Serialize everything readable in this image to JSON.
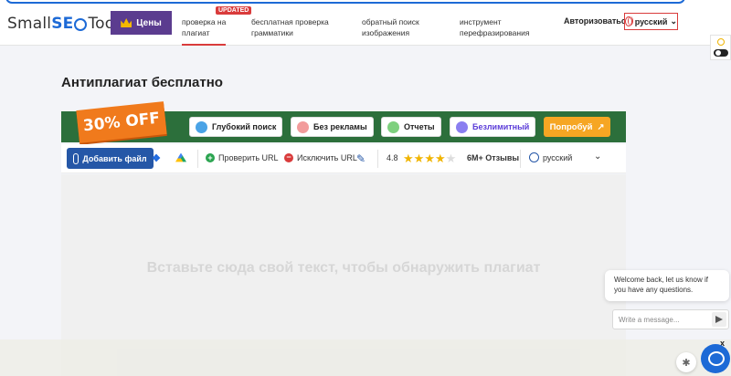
{
  "header": {
    "logo_prefix": "Small",
    "logo_seo": "SE",
    "logo_suffix": "Tools",
    "price_label": "Цены",
    "badge": "UPDATED",
    "nav": [
      {
        "line1": "проверка на",
        "line2": "плагиат"
      },
      {
        "line1": "бесплатная проверка",
        "line2": "грамматики"
      },
      {
        "line1": "обратный поиск",
        "line2": "изображения"
      },
      {
        "line1": "инструмент",
        "line2": "перефразирования"
      }
    ],
    "login": "Авторизоваться",
    "language": "русский"
  },
  "page": {
    "title": "Антиплагиат бесплатно"
  },
  "promo": {
    "off_tag": "30% OFF",
    "chips": [
      "Глубокий поиск",
      "Без рекламы",
      "Отчеты",
      "Безлимитный"
    ],
    "try_label": "Попробуй",
    "colors": {
      "bar": "#2c6f3b",
      "tag": "#f07a1c",
      "try": "#f6a623"
    }
  },
  "tools": {
    "add_file": "Добавить файл",
    "check_url": "Проверить URL",
    "exclude_url": "Исключить URL",
    "rating": "4.8",
    "reviews": "6M+ Отзывы",
    "language": "русский"
  },
  "editor": {
    "placeholder": "Вставьте сюда свой текст, чтобы обнаружить плагиат"
  },
  "chat": {
    "message": "Welcome back, let us know if you have any questions.",
    "input_placeholder": "Write a message...",
    "close": "x"
  }
}
